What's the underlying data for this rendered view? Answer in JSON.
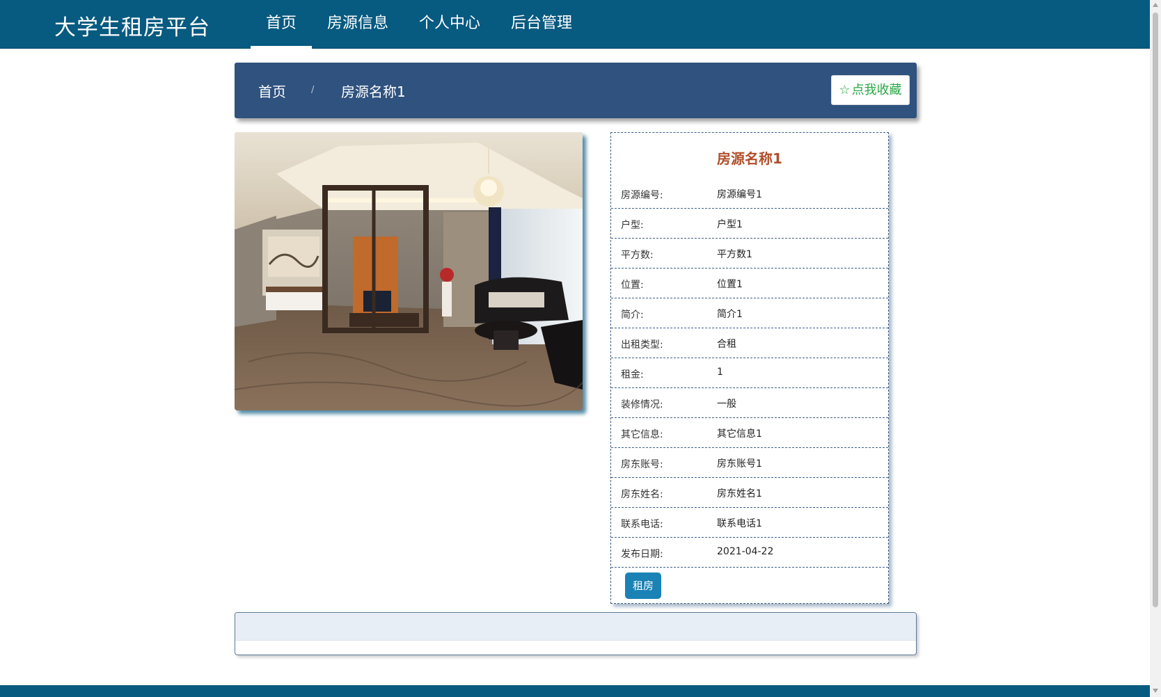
{
  "header": {
    "brand": "大学生租房平台",
    "nav": [
      {
        "label": "首页",
        "active": true
      },
      {
        "label": "房源信息",
        "active": false
      },
      {
        "label": "个人中心",
        "active": false
      },
      {
        "label": "后台管理",
        "active": false
      }
    ]
  },
  "breadcrumb": {
    "home": "首页",
    "separator": "/",
    "current": "房源名称1",
    "favorite_icon": "star-outline-icon",
    "favorite_label": "点我收藏"
  },
  "detail": {
    "title": "房源名称1",
    "fields": [
      {
        "label": "房源编号:",
        "value": "房源编号1"
      },
      {
        "label": "户型:",
        "value": "户型1"
      },
      {
        "label": "平方数:",
        "value": "平方数1"
      },
      {
        "label": "位置:",
        "value": "位置1"
      },
      {
        "label": "简介:",
        "value": "简介1"
      },
      {
        "label": "出租类型:",
        "value": "合租"
      },
      {
        "label": "租金:",
        "value": "1"
      },
      {
        "label": "装修情况:",
        "value": "一般"
      },
      {
        "label": "其它信息:",
        "value": "其它信息1"
      },
      {
        "label": "房东账号:",
        "value": "房东账号1"
      },
      {
        "label": "房东姓名:",
        "value": "房东姓名1"
      },
      {
        "label": "联系电话:",
        "value": "联系电话1"
      },
      {
        "label": "发布日期:",
        "value": "2021-04-22"
      }
    ],
    "rent_button": "租房"
  },
  "colors": {
    "nav_bg": "#075a80",
    "crumb_bg": "#2f527f",
    "title_color": "#b04f2a",
    "favorite_color": "#2aa744",
    "rent_button_bg": "#1a82b5"
  }
}
